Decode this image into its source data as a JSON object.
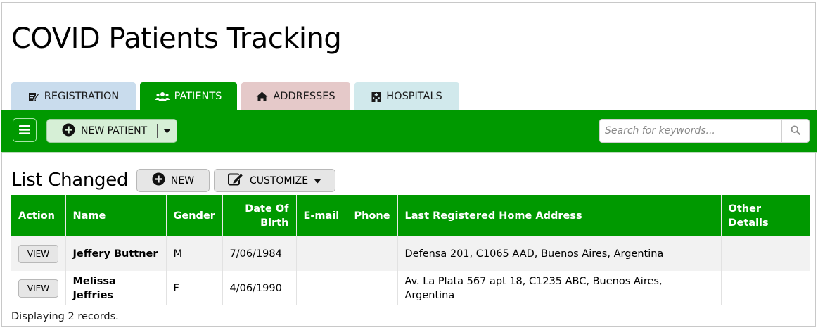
{
  "page": {
    "title": "COVID Patients Tracking"
  },
  "tabs": [
    {
      "label": "REGISTRATION",
      "icon": "registration-edit-icon",
      "active": false,
      "color": "#c9dced"
    },
    {
      "label": "PATIENTS",
      "icon": "users-icon",
      "active": true,
      "color": "#009900"
    },
    {
      "label": "ADDRESSES",
      "icon": "home-icon",
      "active": false,
      "color": "#e5c9c9"
    },
    {
      "label": "HOSPITALS",
      "icon": "hospital-icon",
      "active": false,
      "color": "#d1e9ec"
    }
  ],
  "toolbar": {
    "menu_icon": "hamburger-menu-icon",
    "new_patient_label": "NEW PATIENT",
    "search_placeholder": "Search for keywords...",
    "search_value": "",
    "accent_color": "#009900"
  },
  "list": {
    "title": "List Changed",
    "new_label": "NEW",
    "customize_label": "CUSTOMIZE",
    "columns": [
      "Action",
      "Name",
      "Gender",
      "Date Of Birth",
      "E-mail",
      "Phone",
      "Last Registered Home Address",
      "Other Details"
    ],
    "rows": [
      {
        "action": "VIEW",
        "name": "Jeffery Buttner",
        "gender": "M",
        "dob": "7/06/1984",
        "email": "",
        "phone": "",
        "address": "Defensa 201, C1065 AAD, Buenos Aires, Argentina",
        "other": ""
      },
      {
        "action": "VIEW",
        "name": "Melissa Jeffries",
        "gender": "F",
        "dob": "4/06/1990",
        "email": "",
        "phone": "",
        "address": "Av. La Plata 567 apt 18, C1235 ABC, Buenos Aires, Argentina",
        "other": ""
      }
    ],
    "footer": "Displaying 2 records."
  }
}
